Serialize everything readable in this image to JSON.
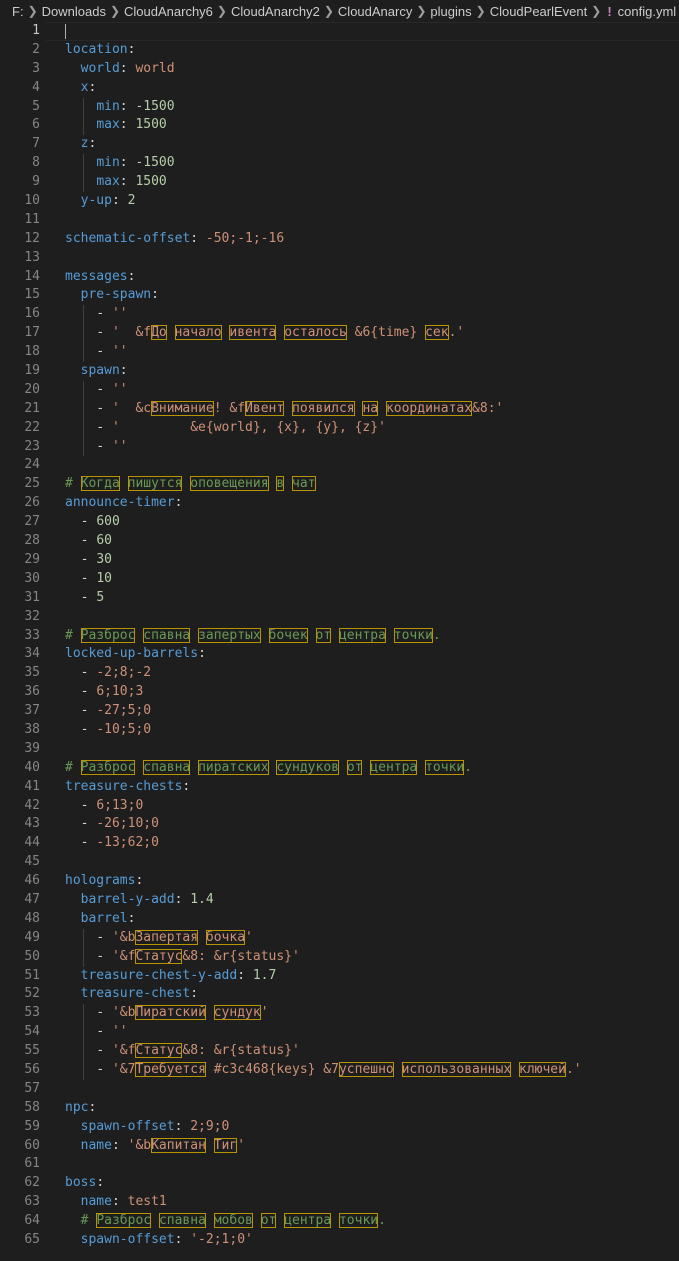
{
  "breadcrumb": {
    "items": [
      "F:",
      "Downloads",
      "CloudAnarchy6",
      "CloudAnarchy2",
      "CloudAnarcy",
      "plugins",
      "CloudPearlEvent"
    ],
    "file_icon": "!",
    "file_name": "config.yml"
  },
  "editor": {
    "language": "yaml",
    "lines": [
      "",
      "location:",
      "  world: world",
      "  x:",
      "    min: -1500",
      "    max: 1500",
      "  z:",
      "    min: -1500",
      "    max: 1500",
      "  y-up: 2",
      "",
      "schematic-offset: -50;-1;-16",
      "",
      "messages:",
      "  pre-spawn:",
      "    - ''",
      "    - '  &fДо начало ивента осталось &6{time} сек.'",
      "    - ''",
      "  spawn:",
      "    - ''",
      "    - '  &cВнимание! &fИвент появился на координатах&8:'",
      "    - '         &e{world}, {x}, {y}, {z}'",
      "    - ''",
      "",
      "# Когда пишутся оповещения в чат",
      "announce-timer:",
      "  - 600",
      "  - 60",
      "  - 30",
      "  - 10",
      "  - 5",
      "",
      "# Разброс спавна запертых бочек от центра точки.",
      "locked-up-barrels:",
      "  - -2;8;-2",
      "  - 6;10;3",
      "  - -27;5;0",
      "  - -10;5;0",
      "",
      "# Разброс спавна пиратских сундуков от центра точки.",
      "treasure-chests:",
      "  - 6;13;0",
      "  - -26;10;0",
      "  - -13;62;0",
      "",
      "holograms:",
      "  barrel-y-add: 1.4",
      "  barrel:",
      "    - '&bЗапертая бочка'",
      "    - '&fСтатус&8: &r{status}'",
      "  treasure-chest-y-add: 1.7",
      "  treasure-chest:",
      "    - '&bПиратский сундук'",
      "    - ''",
      "    - '&fСтатус&8: &r{status}'",
      "    - '&7Требуется #c3c468{keys} &7успешно использованных ключей.'",
      "",
      "npc:",
      "  spawn-offset: 2;9;0",
      "  name: '&bКапитан Тиг'",
      "",
      "boss:",
      "  name: test1",
      "  # Разброс спавна мобов от центра точки.",
      "  spawn-offset: '-2;1;0'"
    ]
  },
  "colors": {
    "background": "#1e1e1e",
    "key": "#569cd6",
    "string": "#ce9178",
    "number": "#b5cea8",
    "comment": "#6a9955",
    "highlight_border": "#b89500"
  }
}
